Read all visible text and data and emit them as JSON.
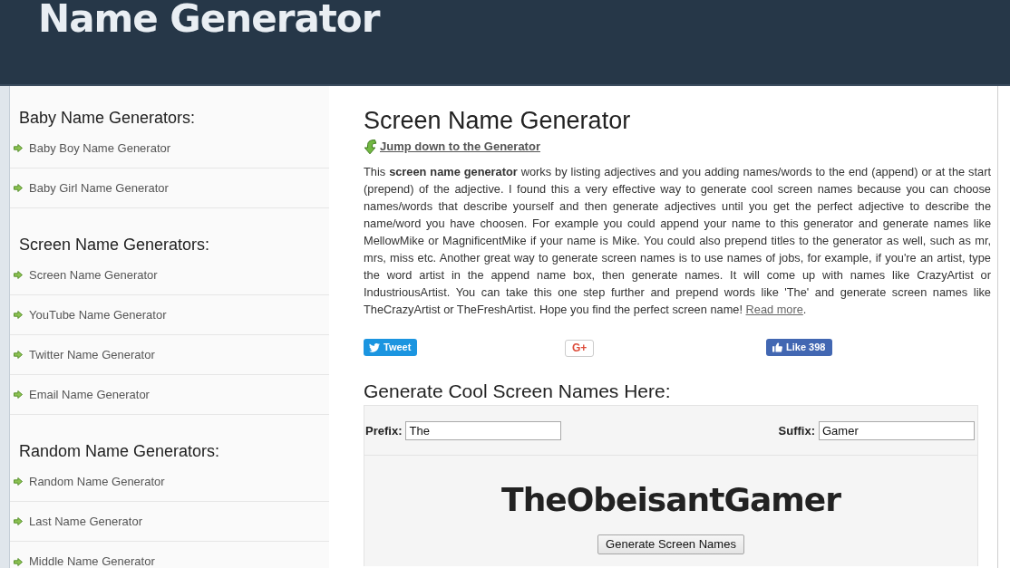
{
  "header": {
    "title": "Name Generator"
  },
  "sidebar": {
    "sections": [
      {
        "heading": "Baby Name Generators:",
        "items": [
          "Baby Boy Name Generator",
          "Baby Girl Name Generator"
        ]
      },
      {
        "heading": "Screen Name Generators:",
        "items": [
          "Screen Name Generator",
          "YouTube Name Generator",
          "Twitter Name Generator",
          "Email Name Generator"
        ]
      },
      {
        "heading": "Random Name Generators:",
        "items": [
          "Random Name Generator",
          "Last Name Generator",
          "Middle Name Generator"
        ]
      }
    ]
  },
  "main": {
    "title": "Screen Name Generator",
    "jump_link": "Jump down to the Generator",
    "intro": "This **screen name generator** works by listing adjectives and you adding names/words to the end (append) or at the start (prepend) of the adjective. I found this a very effective way to generate cool screen names because you can choose names/words that describe yourself and then generate adjectives until you get the perfect adjective to describe the name/word you have choosen. For example you could append your name to this generator and generate names like MellowMike or MagnificentMike if your name is Mike. You could also prepend titles to the generator as well, such as mr, mrs, miss etc. Another great way to generate screen names is to use names of jobs, for example, if you're an artist, type the word artist in the append name box, then generate names. It will come up with names like CrazyArtist or IndustriousArtist. You can take this one step further and prepend words like 'The' and generate screen names like TheCrazyArtist or TheFreshArtist. Hope you find the perfect screen name! ",
    "read_more": "Read more",
    "intro_end": "."
  },
  "social": [
    {
      "kind": "tweet",
      "label": "Tweet"
    },
    {
      "kind": "gplus",
      "label": "G+"
    },
    {
      "kind": "like",
      "label": "Like 398"
    }
  ],
  "generator": {
    "heading": "Generate Cool Screen Names Here:",
    "prefix": {
      "label": "Prefix:",
      "value": "The"
    },
    "suffix": {
      "label": "Suffix:",
      "value": "Gamer"
    },
    "result": "TheObeisantGamer",
    "button": "Generate Screen Names"
  }
}
